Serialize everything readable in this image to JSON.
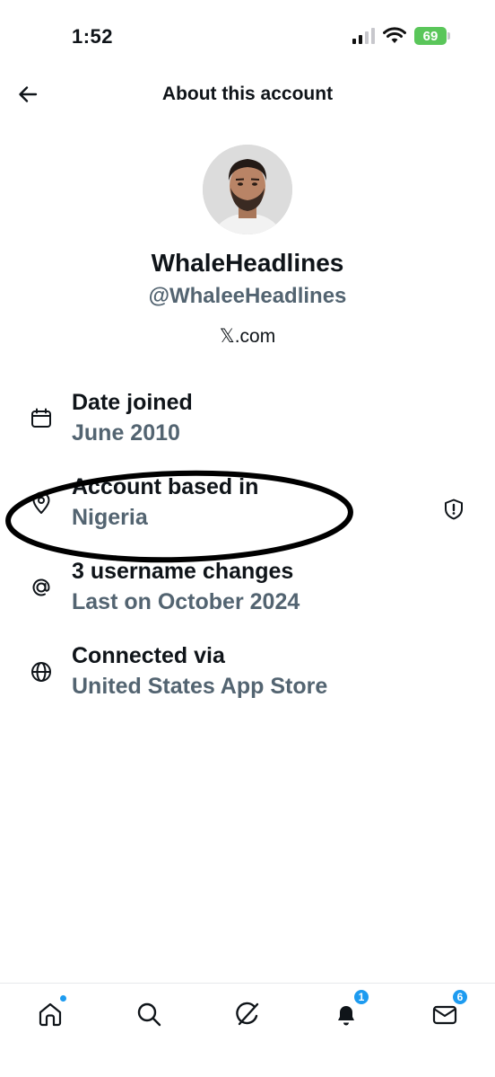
{
  "status_bar": {
    "time": "1:52",
    "battery": "69",
    "battery_color": "#5ac65a",
    "icons": [
      "signal-icon",
      "wifi-icon",
      "battery-icon"
    ]
  },
  "header": {
    "title": "About this account",
    "back_icon": "back-arrow-icon"
  },
  "profile": {
    "name": "WhaleHeadlines",
    "handle": "@WhaleeHeadlines",
    "link": "𝕏.com"
  },
  "info": [
    {
      "icon": "calendar-icon",
      "label": "Date joined",
      "value": "June 2010"
    },
    {
      "icon": "location-pin-icon",
      "label": "Account based in",
      "value": "Nigeria",
      "action_icon": "shield-icon"
    },
    {
      "icon": "at-sign-icon",
      "label": "3 username changes",
      "value": "Last on October 2024"
    },
    {
      "icon": "globe-icon",
      "label": "Connected via",
      "value": "United States App Store"
    }
  ],
  "bottom_nav": {
    "items": [
      {
        "icon": "home-icon",
        "indicator": "dot"
      },
      {
        "icon": "search-icon"
      },
      {
        "icon": "grok-icon"
      },
      {
        "icon": "bell-icon",
        "badge": "1"
      },
      {
        "icon": "mail-icon",
        "badge": "6"
      }
    ]
  },
  "colors": {
    "accent": "#1d9bf0",
    "text_primary": "#0f1419",
    "text_secondary": "#536471"
  }
}
